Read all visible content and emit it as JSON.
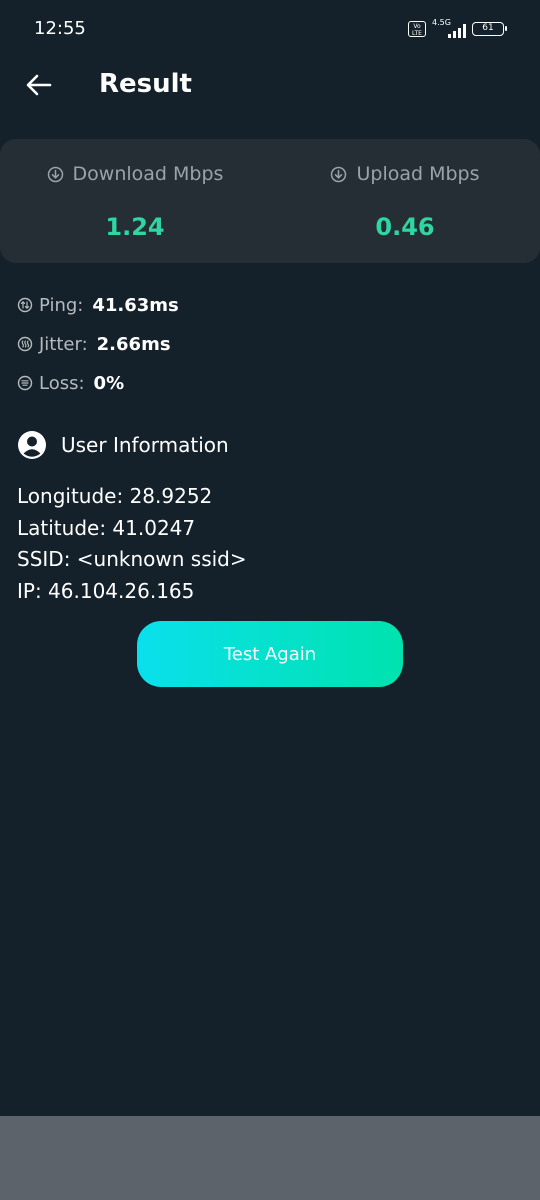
{
  "status_bar": {
    "time": "12:55",
    "volte": [
      "Vo",
      "LTE"
    ],
    "network": "4.5G",
    "battery": "61"
  },
  "app_bar": {
    "title": "Result"
  },
  "speed": {
    "download": {
      "label": "Download Mbps",
      "value": "1.24"
    },
    "upload": {
      "label": "Upload Mbps",
      "value": "0.46"
    }
  },
  "stats": {
    "ping": {
      "label": "Ping:",
      "value": "41.63ms"
    },
    "jitter": {
      "label": "Jitter:",
      "value": "2.66ms"
    },
    "loss": {
      "label": "Loss:",
      "value": "0%"
    }
  },
  "user_info": {
    "title": "User Information",
    "lines": [
      "Longitude: 28.9252",
      "Latitude: 41.0247",
      "SSID: <unknown ssid>",
      "IP: 46.104.26.165"
    ]
  },
  "actions": {
    "test_again": "Test Again"
  },
  "colors": {
    "background": "#15212a",
    "card": "#252e35",
    "accent": "#2fd6a2",
    "button_gradient_start": "#0ae0ec",
    "button_gradient_end": "#00e2ae",
    "nav_bar": "#5c636a"
  },
  "icons": {
    "back": "arrow-left-icon",
    "download": "download-circle-icon",
    "upload": "download-circle-icon",
    "ping": "ping-icon",
    "jitter": "jitter-icon",
    "loss": "loss-icon",
    "user": "account-circle-icon"
  }
}
